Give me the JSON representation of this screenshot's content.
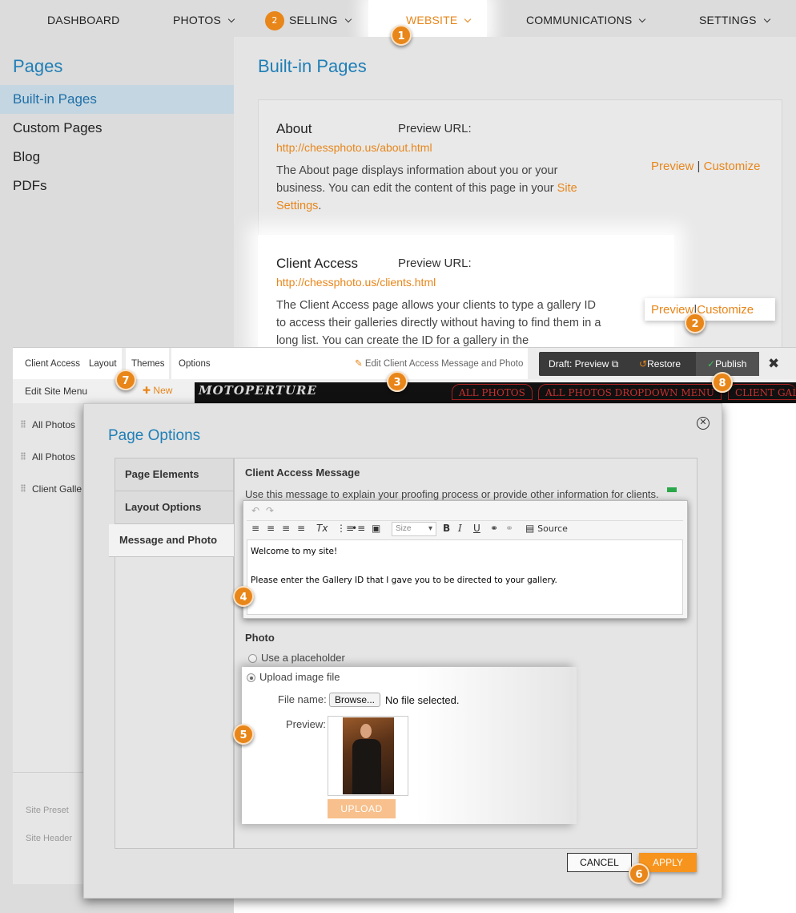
{
  "nav": {
    "dashboard": "DASHBOARD",
    "photos": "PHOTOS",
    "selling": "SELLING",
    "selling_badge": "2",
    "website": "WEBSITE",
    "communications": "COMMUNICATIONS",
    "settings": "SETTINGS"
  },
  "sidebar": {
    "title": "Pages",
    "items": [
      {
        "label": "Built-in Pages"
      },
      {
        "label": "Custom Pages"
      },
      {
        "label": "Blog"
      },
      {
        "label": "PDFs"
      }
    ]
  },
  "main": {
    "title": "Built-in Pages",
    "pages": [
      {
        "name": "About",
        "url_label": "Preview URL:",
        "url": "http://chessphoto.us/about.html",
        "desc_before": "The About page displays information about you or your business. You can edit the content of this page in your ",
        "desc_link": "Site Settings",
        "desc_after": ".",
        "preview": "Preview",
        "sep": "|",
        "customize": "Customize"
      },
      {
        "name": "Client Access",
        "url_label": "Preview URL:",
        "url": "http://chessphoto.us/clients.html",
        "desc": "The Client Access page allows your clients to type a gallery ID to access their galleries directly without having to find them in a long list. You can create the ID for a gallery in the",
        "preview": "Preview",
        "sep": "|",
        "customize": "Customize"
      }
    ]
  },
  "editbar": {
    "page": "Client Access",
    "layout": "Layout",
    "themes": "Themes",
    "options": "Options",
    "edit_message": "Edit Client Access Message and Photo",
    "draft_preview": "Draft: Preview",
    "restore": "Restore",
    "publish": "Publish",
    "close": "✖"
  },
  "site_strip": {
    "logo": "MOTOPERTURE",
    "tabs": [
      "ALL PHOTOS",
      "ALL PHOTOS DROPDOWN MENU",
      "CLIENT GAL"
    ]
  },
  "left_panel": {
    "edit_menu": "Edit Site Menu",
    "new": "New",
    "items": [
      "All Photos",
      "All Photos",
      "Client Galle"
    ],
    "site_preset": "Site Preset",
    "site_header": "Site Header"
  },
  "modal": {
    "title": "Page Options",
    "tabs": [
      "Page Elements",
      "Layout Options",
      "Message and Photo"
    ],
    "message_heading": "Client Access Message",
    "message_help": "Use this message to explain your proofing process or provide other information for clients.",
    "editor": {
      "size_label": "Size",
      "source_label": "Source",
      "lines": [
        "Welcome to my site!",
        "Please enter the Gallery ID that I gave you to be directed to your gallery."
      ]
    },
    "photo_heading": "Photo",
    "option_placeholder": "Use a placeholder",
    "option_upload": "Upload image file",
    "file_name_label": "File name:",
    "browse": "Browse...",
    "no_file": "No file selected.",
    "preview_label": "Preview:",
    "upload": "UPLOAD",
    "cancel": "CANCEL",
    "apply": "APPLY"
  },
  "callouts": [
    "1",
    "2",
    "3",
    "4",
    "5",
    "6",
    "7",
    "8"
  ],
  "colors": {
    "accent": "#e8861a",
    "link_blue": "#1f7fb6",
    "publish_green": "#3fbf5a"
  }
}
